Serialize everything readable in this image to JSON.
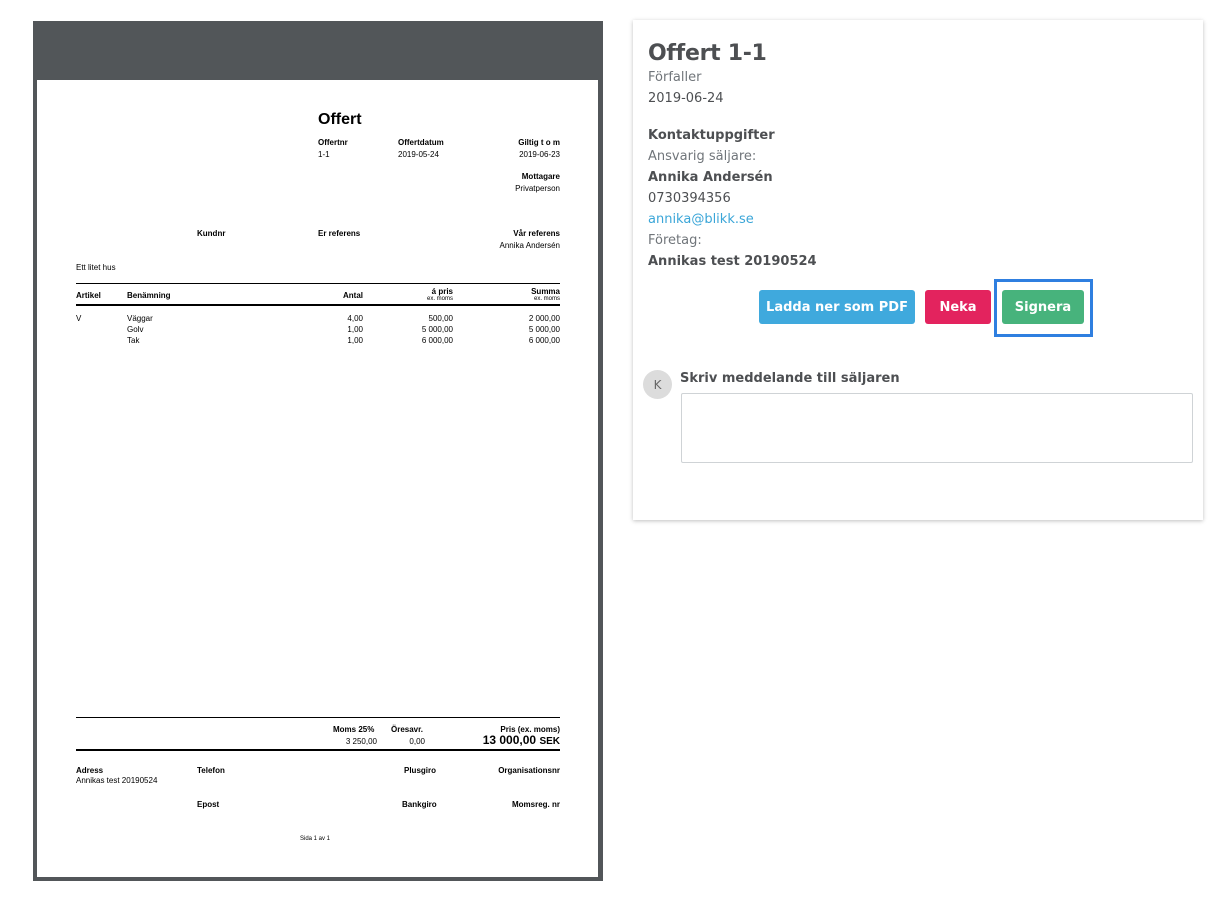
{
  "pdf": {
    "title": "Offert",
    "meta": {
      "offertnr_label": "Offertnr",
      "offertnr": "1-1",
      "offertdatum_label": "Offertdatum",
      "offertdatum": "2019-05-24",
      "giltig_label": "Giltig t o m",
      "giltig": "2019-06-23",
      "mottagare_label": "Mottagare",
      "mottagare": "Privatperson"
    },
    "refs": {
      "kundnr_label": "Kundnr",
      "er_referens_label": "Er referens",
      "var_referens_label": "Vår referens",
      "var_referens": "Annika Andersén"
    },
    "description": "Ett litet hus",
    "table": {
      "headers": {
        "artikel": "Artikel",
        "benamning": "Benämning",
        "antal": "Antal",
        "apris": "á pris",
        "apris_sub": "ex. moms",
        "summa": "Summa",
        "summa_sub": "ex. moms"
      },
      "rows": [
        {
          "artikel": "V",
          "benamning": "Väggar",
          "antal": "4,00",
          "apris": "500,00",
          "summa": "2 000,00"
        },
        {
          "artikel": "",
          "benamning": "Golv",
          "antal": "1,00",
          "apris": "5 000,00",
          "summa": "5 000,00"
        },
        {
          "artikel": "",
          "benamning": "Tak",
          "antal": "1,00",
          "apris": "6 000,00",
          "summa": "6 000,00"
        }
      ]
    },
    "totals": {
      "moms_label": "Moms 25%",
      "moms": "3 250,00",
      "oresavr_label": "Öresavr.",
      "oresavr": "0,00",
      "pris_label": "Pris (ex. moms)",
      "pris": "13 000,00",
      "currency": "SEK"
    },
    "footer": {
      "adress_label": "Adress",
      "adress": "Annikas test 20190524",
      "telefon_label": "Telefon",
      "plusgiro_label": "Plusgiro",
      "orgnr_label": "Organisationsnr",
      "epost_label": "Epost",
      "bankgiro_label": "Bankgiro",
      "momsreg_label": "Momsreg. nr",
      "page_label": "Sida 1 av 1"
    }
  },
  "panel": {
    "title": "Offert 1-1",
    "due_label": "Förfaller",
    "due_date": "2019-06-24",
    "contact_heading": "Kontaktuppgifter",
    "seller_label": "Ansvarig säljare:",
    "seller_name": "Annika Andersén",
    "seller_phone": "0730394356",
    "seller_email": "annika@blikk.se",
    "company_label": "Företag:",
    "company_name": "Annikas test 20190524",
    "buttons": {
      "download_pdf": "Ladda ner som PDF",
      "decline": "Neka",
      "sign": "Signera"
    },
    "message": {
      "avatar_initial": "K",
      "label": "Skriv meddelande till säljaren",
      "value": ""
    }
  },
  "colors": {
    "viewer_bg": "#525659",
    "pdf_button": "#3fa9dd",
    "decline_button": "#e3235e",
    "sign_button": "#47b37c",
    "focus": "#2f7fe0",
    "link": "#3ba6d8"
  }
}
